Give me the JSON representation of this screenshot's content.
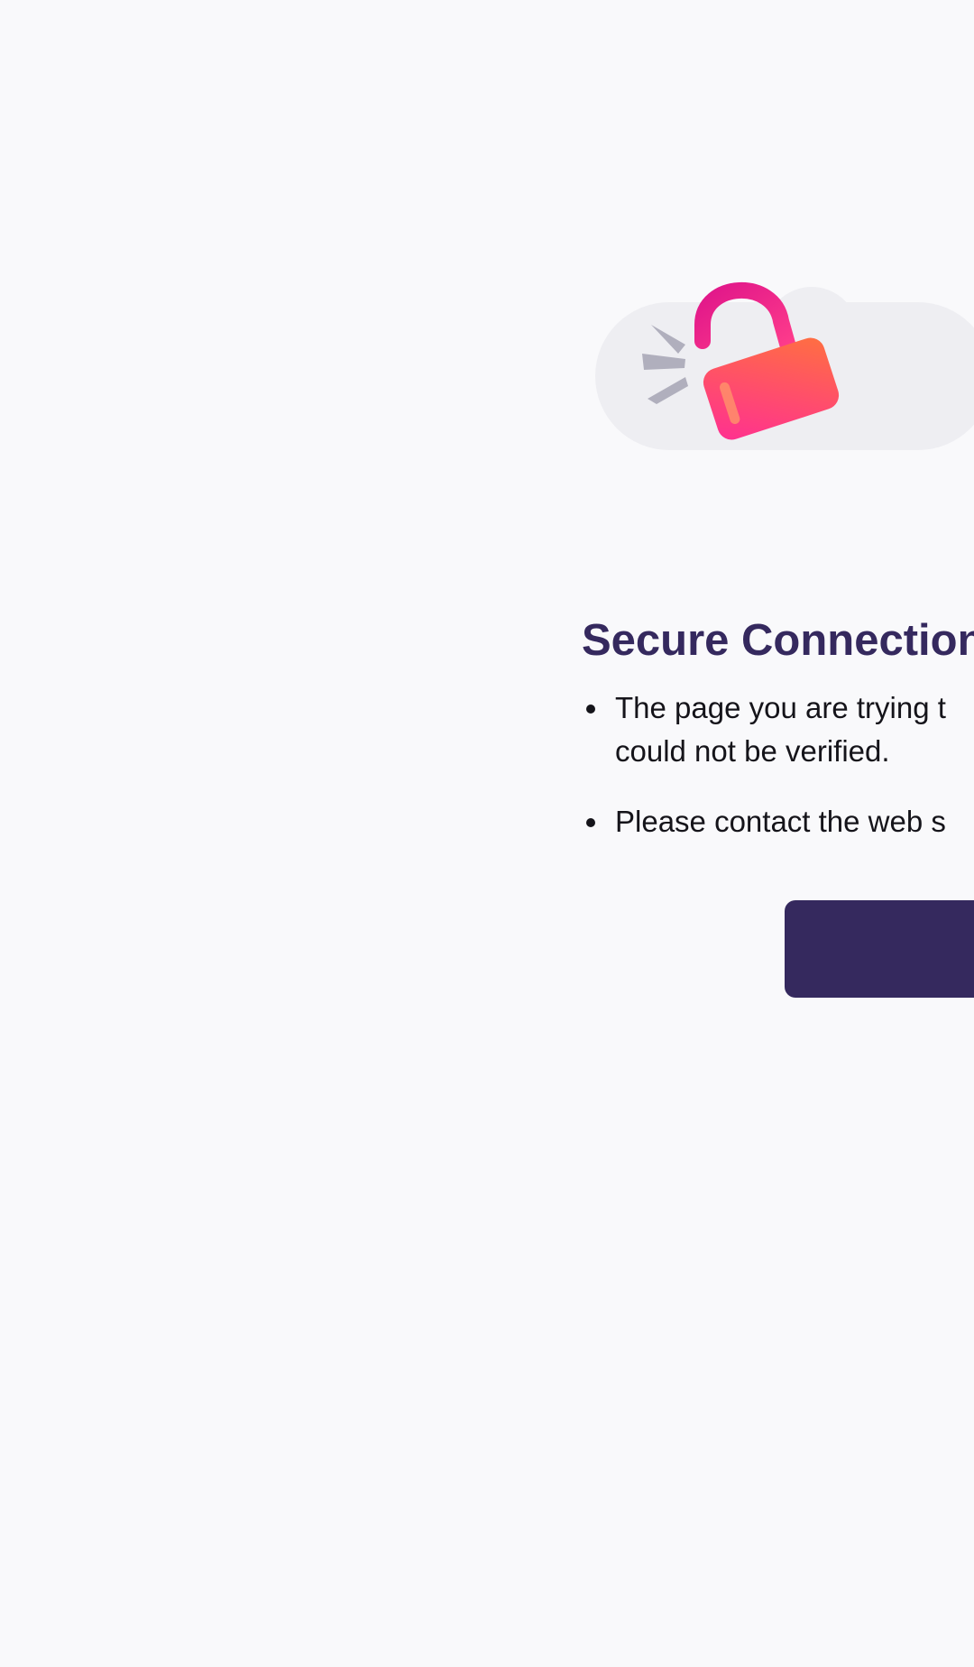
{
  "page": {
    "title": "Secure Connection",
    "bullets": [
      {
        "line1": "The page you are trying t",
        "line2": "could not be verified."
      },
      {
        "line1": "Please contact the web s"
      }
    ],
    "primary_button_label": ""
  },
  "icons": {
    "illustration": "broken-padlock-with-cloud"
  },
  "colors": {
    "background": "#f9f9fb",
    "title": "#35295e",
    "text": "#15141a",
    "button": "#35295e",
    "lock_pink": "#ff3d8b",
    "lock_orange": "#ff6a4a",
    "shackle": "#e81f85"
  }
}
